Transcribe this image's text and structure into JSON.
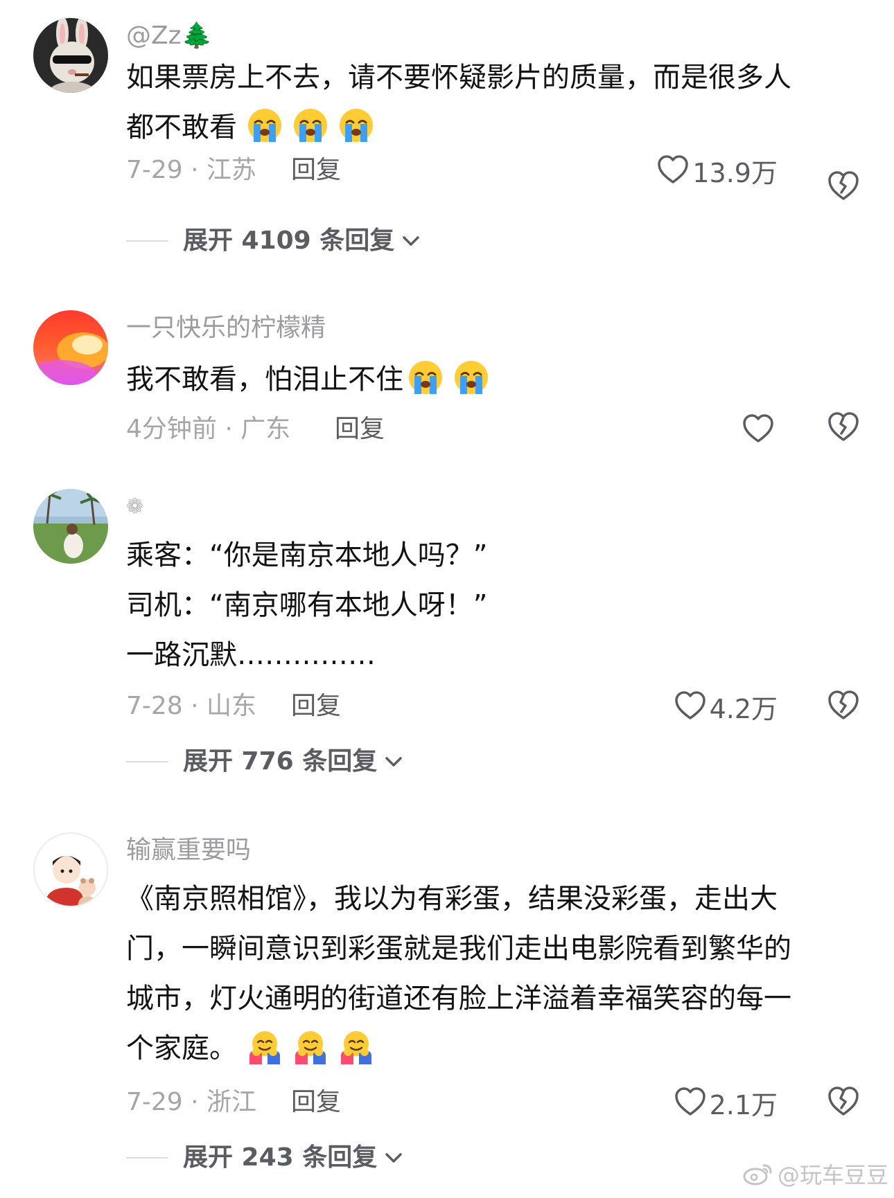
{
  "comments": [
    {
      "username": "@Zz🌲",
      "lines": [
        "如果票房上不去，请不要怀疑影片的质量，而是很多人",
        "都不敢看"
      ],
      "emoji_icon": "loudly-crying-face",
      "emoji_count": 3,
      "date_location": "7-29 · 江苏",
      "reply_label": "回复",
      "likes": "13.9万",
      "expand_label": "展开 4109 条回复"
    },
    {
      "username": "一只快乐的柠檬精",
      "lines": [
        "我不敢看，怕泪止不住"
      ],
      "emoji_icon": "loudly-crying-face",
      "emoji_count": 2,
      "date_location": "4分钟前 · 广东",
      "reply_label": "回复",
      "likes": ""
    },
    {
      "username": "❁",
      "lines": [
        "乘客：“你是南京本地人吗？”",
        "司机：“南京哪有本地人呀！”",
        "一路沉默……………"
      ],
      "date_location": "7-28 · 山东",
      "reply_label": "回复",
      "likes": "4.2万",
      "expand_label": "展开 776 条回复"
    },
    {
      "username": "输赢重要吗",
      "lines": [
        "《南京照相馆》，我以为有彩蛋，结果没彩蛋，走出大",
        "门，一瞬间意识到彩蛋就是我们走出电影院看到繁华的",
        "城市，灯火通明的街道还有脸上洋溢着幸福笑容的每一",
        "个家庭。"
      ],
      "emoji_icon": "hugging-face",
      "emoji_count": 3,
      "date_location": "7-29 · 浙江",
      "reply_label": "回复",
      "likes": "2.1万",
      "expand_label": "展开 243 条回复"
    }
  ],
  "watermark": "@玩车豆豆",
  "icons": [
    "heart-outline-icon",
    "broken-heart-icon",
    "chevron-down-icon",
    "weibo-logo-icon"
  ],
  "colors": {
    "text": "#131313",
    "muted": "#9b9ca0",
    "action": "#5b5c61",
    "divider": "#dcdcde"
  }
}
